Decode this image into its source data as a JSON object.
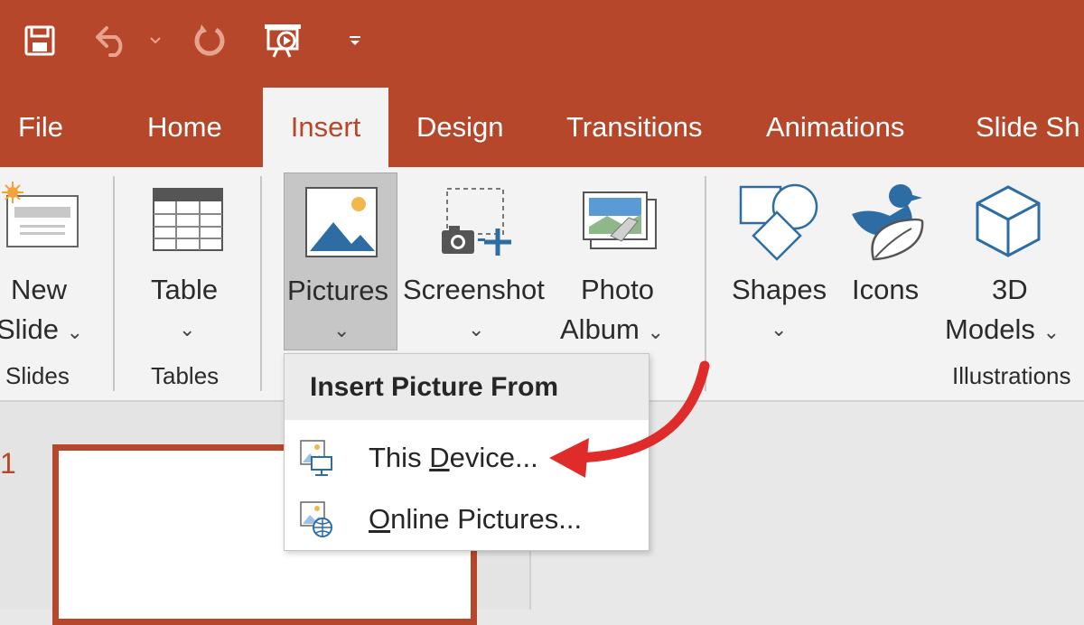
{
  "window": {
    "accent": "#b7472a"
  },
  "quick_access": [
    {
      "name": "save-icon"
    },
    {
      "name": "undo-icon"
    },
    {
      "name": "redo-icon"
    },
    {
      "name": "present-from-start-icon"
    },
    {
      "name": "customize-toolbar-icon"
    }
  ],
  "tabs": {
    "file": "File",
    "home": "Home",
    "insert": "Insert",
    "design": "Design",
    "transitions": "Transitions",
    "animations": "Animations",
    "slideshow": "Slide Sh"
  },
  "ribbon": {
    "new_slide_line1": "New",
    "new_slide_line2": "Slide",
    "table": "Table",
    "pictures": "Pictures",
    "screenshot": "Screenshot",
    "photo_album_line1": "Photo",
    "photo_album_line2": "Album",
    "shapes": "Shapes",
    "icons": "Icons",
    "models_line1": "3D",
    "models_line2": "Models",
    "caret": "⌄",
    "groups": {
      "slides": "Slides",
      "tables": "Tables",
      "illustrations": "Illustrations"
    }
  },
  "slides_pane": {
    "slide_number": "1"
  },
  "menu": {
    "title": "Insert Picture From",
    "this_device_pre": "This ",
    "this_device_accel": "D",
    "this_device_post": "evice...",
    "online_accel": "O",
    "online_post": "nline Pictures..."
  },
  "annotation": {
    "arrow_color": "#e02b2b"
  }
}
